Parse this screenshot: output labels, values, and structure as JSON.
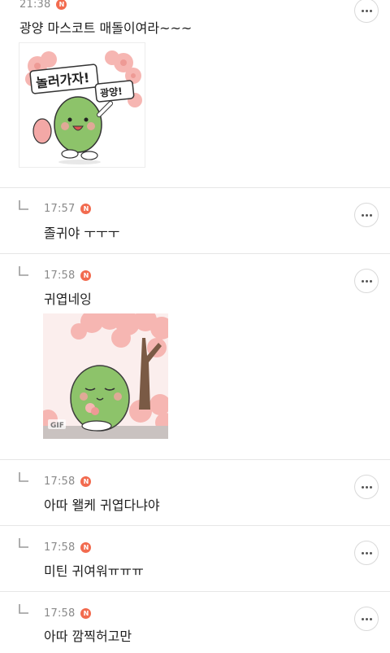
{
  "comments": [
    {
      "time": "21:38",
      "badge": "N",
      "text": "광양 마스코트 매돌이여라~~~",
      "sticker_text_1": "놀러가자!",
      "sticker_text_2": "광양!"
    },
    {
      "time": "17:57",
      "badge": "N",
      "text": "졸귀야 ㅜㅜㅜ"
    },
    {
      "time": "17:58",
      "badge": "N",
      "text": "귀엽네잉",
      "gif_label": "GIF"
    },
    {
      "time": "17:58",
      "badge": "N",
      "text": "아따 왤케 귀엽다냐야"
    },
    {
      "time": "17:58",
      "badge": "N",
      "text": "미틴 귀여워ㅠㅠㅠ"
    },
    {
      "time": "17:58",
      "badge": "N",
      "text": "아따 깜찍허고만"
    }
  ],
  "colors": {
    "accent_badge": "#f26b4f",
    "mascot_green": "#8dc36a",
    "blossom_pink": "#f6b6b2"
  },
  "icons": {
    "reply": "reply-arrow-icon",
    "more": "more-options-icon"
  }
}
